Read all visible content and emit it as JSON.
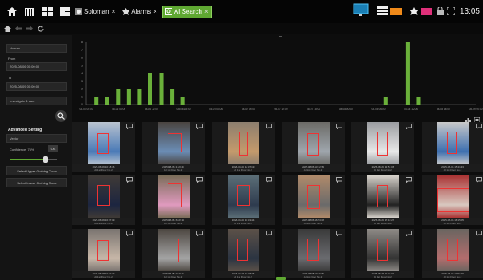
{
  "topbar": {
    "tabs": [
      {
        "label": "Soloman",
        "close": "×"
      },
      {
        "label": "Alarms",
        "close": "×"
      },
      {
        "label": "AI Search",
        "close": "×"
      }
    ],
    "clock": "13:05"
  },
  "left": {
    "category": "Human",
    "from_label": "From",
    "from_value": "2025-08-06 00:00:00",
    "to_label": "To",
    "to_value": "2025-08-09 00:00:00",
    "investigate": "Investigate 1 cam",
    "advanced_title": "Advanced Setting",
    "mode": "Vector",
    "confidence_label": "Confidence: 75%",
    "confidence_value": 0.75,
    "ok_label": "OK",
    "upper_btn": "Select Upper Clothing Color",
    "lower_btn": "Select Lower Clothing Color"
  },
  "chart_data": {
    "type": "bar",
    "y_ticks": [
      "0",
      "1",
      "2",
      "3",
      "4",
      "5",
      "6",
      "7",
      "8"
    ],
    "ylim": [
      0,
      8
    ],
    "x_ticks": [
      "08-06 00:00",
      "08-06 06:00",
      "08-06 12:00",
      "08-06 18:00",
      "08-07 00:00",
      "08-07 06:00",
      "08-07 12:00",
      "08-07 18:00",
      "08-08 00:00",
      "08-08 06:00",
      "08-08 12:00",
      "08-08 18:00",
      "08-09 00:00"
    ],
    "bar_positions": [
      3,
      7,
      11,
      15,
      19,
      23,
      27,
      31,
      35,
      110,
      118,
      122
    ],
    "values": [
      1,
      1,
      2,
      2,
      2,
      4,
      4,
      2,
      1,
      1,
      8,
      1
    ],
    "color": "#6ab03a"
  },
  "results": [
    {
      "time": "2025-08-06 10:18:46",
      "cam": "AI 1st Floor No.2"
    },
    {
      "time": "2025-08-06 11:23:41",
      "cam": "AI 1st Floor No.2"
    },
    {
      "time": "2025-08-06 12:37:19",
      "cam": "AI 1st Floor No.2"
    },
    {
      "time": "2025-08-06 13:12:54",
      "cam": "AI 1st Floor No.2"
    },
    {
      "time": "2025-08-06 14:51:06",
      "cam": "AI 1st Floor No.2"
    },
    {
      "time": "2025-08-06 15:41:33",
      "cam": "AI 1st Floor No.2"
    },
    {
      "time": "2025-08-06 16:07:09",
      "cam": "AI 1st Floor No.2"
    },
    {
      "time": "2025-08-06 16:22:18",
      "cam": "AI 1st Floor No.2"
    },
    {
      "time": "2025-08-06 16:31:44",
      "cam": "AI 1st Floor No.2"
    },
    {
      "time": "2025-08-06 16:53:08",
      "cam": "AI 1st Floor No.2"
    },
    {
      "time": "2025-08-06 17:10:27",
      "cam": "AI 1st Floor No.2"
    },
    {
      "time": "2025-08-06 18:15:05",
      "cam": "AI 1st Floor No.2"
    },
    {
      "time": "2025-08-08 10:42:37",
      "cam": "AI 1st Floor No.2"
    },
    {
      "time": "2025-08-08 10:44:13",
      "cam": "AI 1st Floor No.2"
    },
    {
      "time": "2025-08-08 10:45:26",
      "cam": "AI 1st Floor No.2"
    },
    {
      "time": "2025-08-08 10:46:51",
      "cam": "AI 1st Floor No.2"
    },
    {
      "time": "2025-08-08 10:48:03",
      "cam": "AI 1st Floor No.2"
    },
    {
      "time": "2025-08-08 10:51:29",
      "cam": "AI 1st Floor No.2"
    }
  ],
  "colors": {
    "accent": "#5fa832",
    "box": "#e33333"
  }
}
